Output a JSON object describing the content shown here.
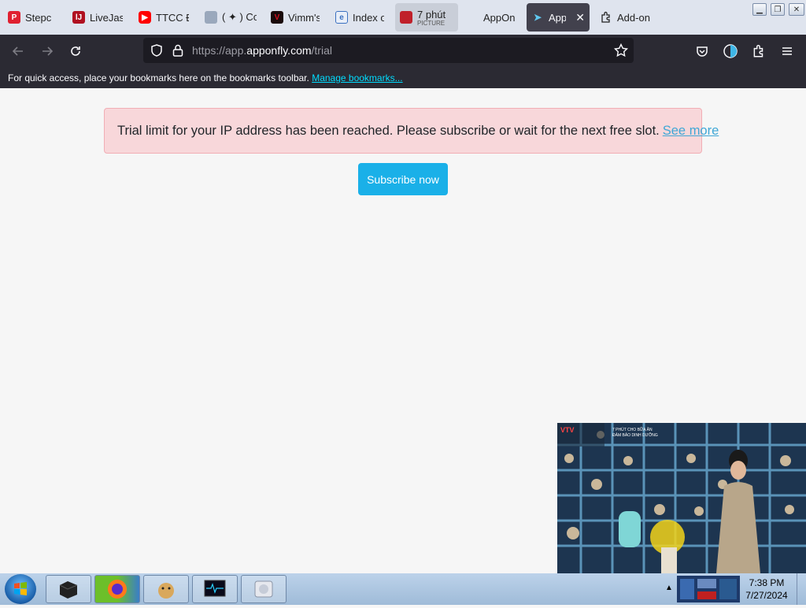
{
  "tabs": [
    {
      "label": "Stepc",
      "icon": "p-red-icon",
      "color": "#e02030"
    },
    {
      "label": "LiveJasn",
      "icon": "lj-icon",
      "color": "#b01020"
    },
    {
      "label": "TTCC Đ",
      "icon": "youtube-icon",
      "color": "#ff0000"
    },
    {
      "label": "( ✦ ) Co",
      "icon": "image-icon",
      "color": "#7a8aa0"
    },
    {
      "label": "Vimm's",
      "icon": "vimm-icon",
      "color": "#a00010"
    },
    {
      "label": "Index o",
      "icon": "ie-page-icon",
      "color": "#3a70c0"
    },
    {
      "label": "7 phút",
      "sublabel": "PICTURE",
      "icon": "video-icon",
      "color": "#c0202a"
    },
    {
      "label": "AppOn",
      "icon": "",
      "color": ""
    },
    {
      "label": "App",
      "icon": "apponfly-icon",
      "color": "#42414d",
      "close": "✕"
    },
    {
      "label": "Add-on",
      "icon": "puzzle-icon",
      "color": ""
    }
  ],
  "nav": {
    "url_prefix": "https://app.",
    "url_host": "apponfly.com",
    "url_path": "/trial"
  },
  "bookmarks": {
    "message": "For quick access, place your bookmarks here on the bookmarks toolbar.",
    "manage_link": "Manage bookmarks..."
  },
  "alert": {
    "message": "Trial limit for your IP address has been reached. Please subscribe or wait for the next free slot.",
    "link": "See more"
  },
  "subscribe_label": "Subscribe now",
  "pip": {
    "channel": "VTV",
    "caption_line1": "7 PHÚT CHO BỮA ĂN",
    "caption_line2": "ĐẢM BẢO DINH DƯỠNG"
  },
  "taskbar": {
    "time": "7:38 PM",
    "date": "7/27/2024"
  },
  "colors": {
    "alert_bg": "#f8d7da",
    "alert_link": "#3fa7d6",
    "button": "#1ab0e8",
    "toolbar": "#2b2a33"
  }
}
